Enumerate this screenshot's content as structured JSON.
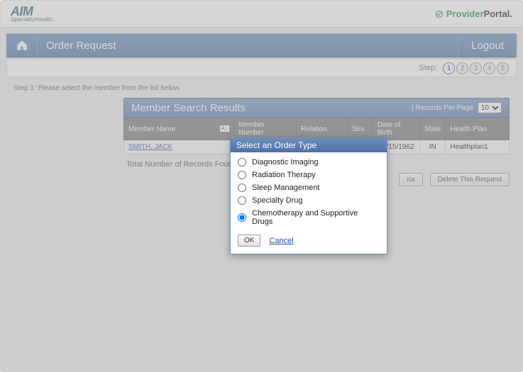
{
  "brand": {
    "main": "AIM",
    "sub": "SpecialtyHealth."
  },
  "portal": {
    "provider": "Provider",
    "portal": "Portal"
  },
  "nav": {
    "title": "Order Request",
    "logout": "Logout"
  },
  "steps": {
    "label": "Step:",
    "items": [
      "1",
      "2",
      "3",
      "4",
      "5"
    ],
    "activeIndex": 0
  },
  "instruction": "Step 1: Please select the member from the list below.",
  "panel": {
    "title": "Member Search Results",
    "rpp_label": "|  Records Per Page",
    "rpp_value": "10"
  },
  "columns": {
    "name": "Member Name",
    "number": "Member Number",
    "relation": "Relation",
    "sex": "Sex",
    "dob": "Date of Birth",
    "state": "State",
    "plan": "Health Plan"
  },
  "rows": [
    {
      "name": "SMITH, JACK",
      "number": "",
      "relation": "",
      "sex": "",
      "dob": "04/15/1962",
      "state": "IN",
      "plan": "Healthplan1"
    }
  ],
  "totals": "Total Number of Records Found: 1",
  "actions": {
    "change_criteria_suffix": "ria",
    "delete": "Delete This Request"
  },
  "modal": {
    "title": "Select an Order Type",
    "options": [
      "Diagnostic Imaging",
      "Radiation Therapy",
      "Sleep Management",
      "Specialty Drug",
      "Chemotherapy and Supportive Drugs"
    ],
    "selectedIndex": 4,
    "ok": "OK",
    "cancel": "Cancel"
  }
}
